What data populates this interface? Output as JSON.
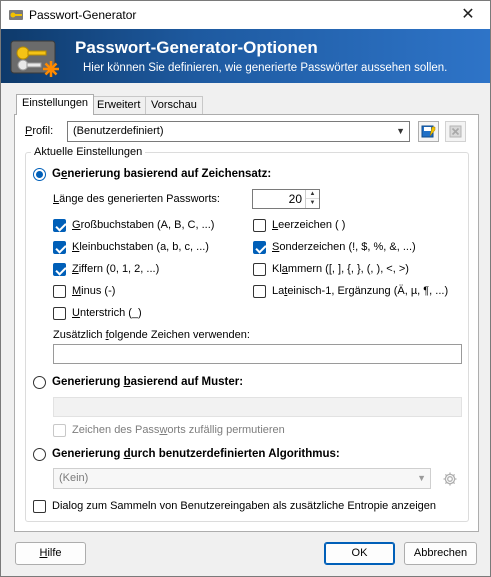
{
  "window": {
    "title": "Passwort-Generator",
    "close_glyph": "✕"
  },
  "banner": {
    "heading": "Passwort-Generator-Optionen",
    "subheading": "Hier können Sie definieren, wie generierte Passwörter aussehen sollen."
  },
  "tabs": [
    "Einstellungen",
    "Erweitert",
    "Vorschau"
  ],
  "profile": {
    "label": "Profil:",
    "value": "(Benutzerdefiniert)"
  },
  "group_title": "Aktuelle Einstellungen",
  "charset": {
    "radio_label": "Generierung basierend auf Zeichensatz:",
    "length_label": "Länge des generierten Passworts:",
    "length_value": "20",
    "options": [
      {
        "label": "Großbuchstaben (A, B, C, ...)",
        "checked": true
      },
      {
        "label": "Leerzeichen ( )",
        "checked": false
      },
      {
        "label": "Kleinbuchstaben (a, b, c, ...)",
        "checked": true
      },
      {
        "label": "Sonderzeichen (!, $, %, &, ...)",
        "checked": true
      },
      {
        "label": "Ziffern (0, 1, 2, ...)",
        "checked": true
      },
      {
        "label": "Klammern ([, ], {, }, (, ), <, >)",
        "checked": false
      },
      {
        "label": "Minus (-)",
        "checked": false
      },
      {
        "label": "Lateinisch-1, Ergänzung (Ä, µ, ¶, ...)",
        "checked": false
      },
      {
        "label": "Unterstrich (_)",
        "checked": false
      }
    ],
    "additional_label": "Zusätzlich folgende Zeichen verwenden:",
    "additional_value": ""
  },
  "pattern": {
    "radio_label": "Generierung basierend auf Muster:",
    "value": "",
    "permute_label": "Zeichen des Passworts zufällig permutieren"
  },
  "custom": {
    "radio_label": "Generierung durch benutzerdefinierten Algorithmus:",
    "value": "(Kein)"
  },
  "entropy_label": "Dialog zum Sammeln von Benutzereingaben als zusätzliche Entropie anzeigen",
  "buttons": {
    "help": "Hilfe",
    "ok": "OK",
    "cancel": "Abbrechen"
  }
}
